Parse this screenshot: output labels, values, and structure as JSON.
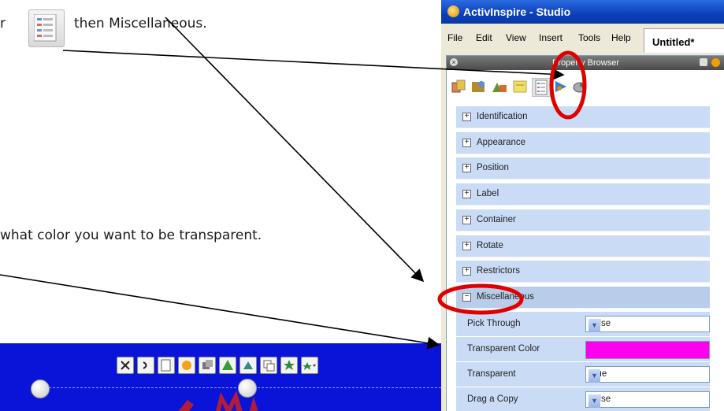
{
  "instructions": {
    "line1_prefix": "r",
    "line1_suffix": "then Miscellaneous.",
    "line2": "what color you want to be transparent."
  },
  "icons": {
    "properties": "properties-sheet-icon"
  },
  "window": {
    "title": "ActivInspire - Studio",
    "menu": [
      "File",
      "Edit",
      "View",
      "Insert",
      "Tools",
      "Help"
    ],
    "document_tab": "Untitled*"
  },
  "property_browser": {
    "title": "Property Browser",
    "sections": [
      {
        "label": "Identification",
        "expanded": false
      },
      {
        "label": "Appearance",
        "expanded": false
      },
      {
        "label": "Position",
        "expanded": false
      },
      {
        "label": "Label",
        "expanded": false
      },
      {
        "label": "Container",
        "expanded": false
      },
      {
        "label": "Rotate",
        "expanded": false
      },
      {
        "label": "Restrictors",
        "expanded": false
      },
      {
        "label": "Miscellaneous",
        "expanded": true
      }
    ],
    "misc_properties": [
      {
        "label": "Pick Through",
        "value": "False",
        "type": "dropdown"
      },
      {
        "label": "Transparent Color",
        "value": "",
        "type": "color",
        "color": "#ff00ee"
      },
      {
        "label": "Transparent",
        "value": "True",
        "type": "dropdown"
      },
      {
        "label": "Drag a Copy",
        "value": "False",
        "type": "dropdown"
      }
    ]
  },
  "colors": {
    "highlight_circle": "#e00000",
    "transparent_color": "#ff00ee",
    "canvas_background": "#0a14d8",
    "section_background": "#c9dbf5"
  }
}
